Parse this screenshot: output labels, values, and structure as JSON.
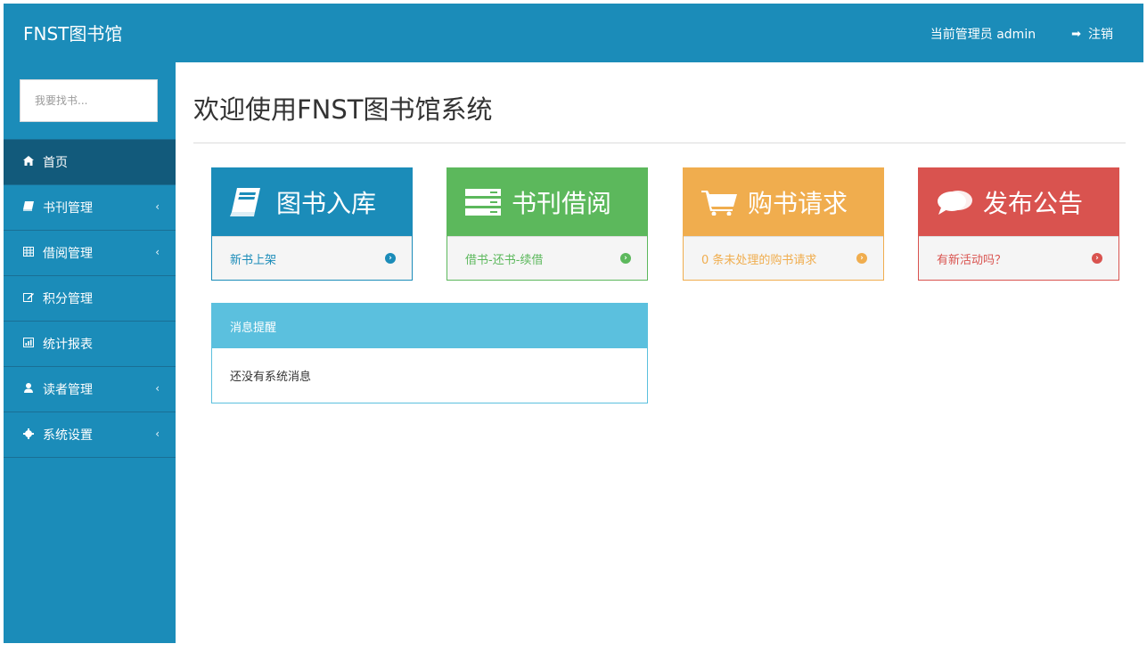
{
  "header": {
    "brand": "FNST图书馆",
    "admin_text": "当前管理员 admin",
    "logout_label": "注销"
  },
  "sidebar": {
    "search_placeholder": "我要找书...",
    "items": [
      {
        "label": "首页",
        "icon": "home-icon",
        "active": true,
        "has_submenu": false
      },
      {
        "label": "书刊管理",
        "icon": "book-icon",
        "active": false,
        "has_submenu": true
      },
      {
        "label": "借阅管理",
        "icon": "table-icon",
        "active": false,
        "has_submenu": true
      },
      {
        "label": "积分管理",
        "icon": "edit-icon",
        "active": false,
        "has_submenu": false
      },
      {
        "label": "统计报表",
        "icon": "bar-chart-icon",
        "active": false,
        "has_submenu": false
      },
      {
        "label": "读者管理",
        "icon": "user-icon",
        "active": false,
        "has_submenu": true
      },
      {
        "label": "系统设置",
        "icon": "gear-icon",
        "active": false,
        "has_submenu": true
      }
    ],
    "submenu_glyph": "‹"
  },
  "main": {
    "title": "欢迎使用FNST图书馆系统",
    "cards": [
      {
        "title": "图书入库",
        "link": "新书上架",
        "icon": "book-icon",
        "color": "#1b8cb9"
      },
      {
        "title": "书刊借阅",
        "link": "借书-还书-续借",
        "icon": "server-icon",
        "color": "#5cb85c"
      },
      {
        "title": "购书请求",
        "link": "0 条未处理的购书请求",
        "icon": "shopping-cart-icon",
        "color": "#f0ad4e"
      },
      {
        "title": "发布公告",
        "link": "有新活动吗？",
        "icon": "comments-icon",
        "color": "#d9534f"
      }
    ],
    "message_panel": {
      "heading": "消息提醒",
      "body": "还没有系统消息"
    }
  },
  "colors": {
    "primary": "#1b8cb9",
    "sidebar_active": "#125a7b",
    "success": "#5cb85c",
    "warning": "#f0ad4e",
    "danger": "#d9534f",
    "info": "#5bc0de"
  }
}
